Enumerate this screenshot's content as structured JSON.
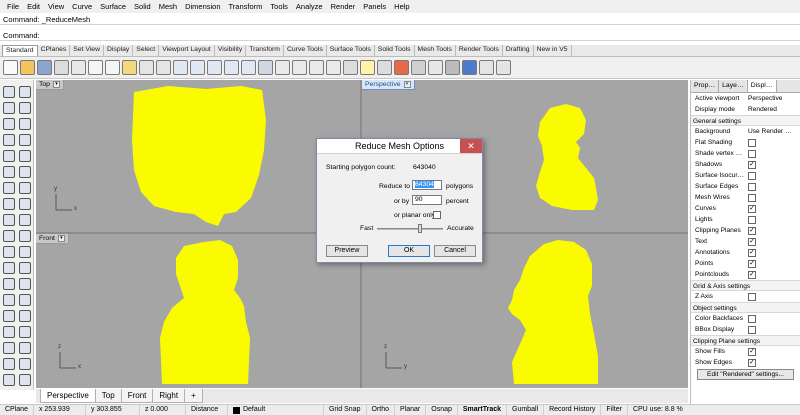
{
  "menu": [
    "File",
    "Edit",
    "View",
    "Curve",
    "Surface",
    "Solid",
    "Mesh",
    "Dimension",
    "Transform",
    "Tools",
    "Analyze",
    "Render",
    "Panels",
    "Help"
  ],
  "command_history": "Command: _ReduceMesh",
  "command_prompt": "Command:",
  "toolbar_tabs": [
    "Standard",
    "CPlanes",
    "Set View",
    "Display",
    "Select",
    "Viewport Layout",
    "Visibility",
    "Transform",
    "Curve Tools",
    "Surface Tools",
    "Solid Tools",
    "Mesh Tools",
    "Render Tools",
    "Drafting",
    "New in V5"
  ],
  "viewports": {
    "top": {
      "title": "Top",
      "axis_x": "x",
      "axis_y": "y"
    },
    "perspective": {
      "title": "Perspective"
    },
    "front": {
      "title": "Front",
      "axis_x": "x",
      "axis_z": "z"
    },
    "right": {
      "title": "Right",
      "axis_y": "y",
      "axis_z": "z"
    }
  },
  "viewport_tabs": [
    "Perspective",
    "Top",
    "Front",
    "Right"
  ],
  "viewport_tab_add": "+",
  "dialog": {
    "title": "Reduce Mesh Options",
    "close": "✕",
    "starting_label": "Starting polygon count:",
    "starting_value": "643040",
    "reduce_to_label": "Reduce to",
    "reduce_to_value": "64304",
    "polygons_label": "polygons",
    "or_by_label": "or by",
    "or_by_value": "90",
    "percent_label": "percent",
    "planar_label": "or planar only",
    "fast_label": "Fast",
    "accurate_label": "Accurate",
    "preview_btn": "Preview",
    "ok_btn": "OK",
    "cancel_btn": "Cancel"
  },
  "panel": {
    "tabs": [
      "Prop…",
      "Laye…",
      "Displ…"
    ],
    "active_viewport_label": "Active viewport",
    "active_viewport_value": "Perspective",
    "display_mode_label": "Display mode",
    "display_mode_value": "Rendered",
    "general_header": "General settings",
    "background_label": "Background",
    "background_value": "Use Render …",
    "general_rows": [
      {
        "label": "Flat Shading",
        "checked": false
      },
      {
        "label": "Shade vertex …",
        "checked": false
      },
      {
        "label": "Shadows",
        "checked": true
      },
      {
        "label": "Surface Isocur…",
        "checked": false
      },
      {
        "label": "Surface Edges",
        "checked": false
      },
      {
        "label": "Mesh Wires",
        "checked": false
      },
      {
        "label": "Curves",
        "checked": true
      },
      {
        "label": "Lights",
        "checked": false
      },
      {
        "label": "Clipping Planes",
        "checked": true
      },
      {
        "label": "Text",
        "checked": true
      },
      {
        "label": "Annotations",
        "checked": true
      },
      {
        "label": "Points",
        "checked": true
      },
      {
        "label": "Pointclouds",
        "checked": true
      }
    ],
    "grid_header": "Grid & Axis settings",
    "grid_rows": [
      {
        "label": "Z Axis",
        "checked": false
      }
    ],
    "object_header": "Object settings",
    "object_rows": [
      {
        "label": "Color Backfaces",
        "checked": false
      },
      {
        "label": "BBox Display",
        "checked": false
      }
    ],
    "clip_header": "Clipping Plane settings",
    "clip_rows": [
      {
        "label": "Show Fills",
        "checked": true
      },
      {
        "label": "Show Edges",
        "checked": true
      }
    ],
    "edit_button": "Edit \"Rendered\" settings...",
    "check_mark": "✓"
  },
  "status": {
    "cplane": "CPlane",
    "x": "x 253.939",
    "y": "y 303.855",
    "z": "z 0.000",
    "distance": "Distance",
    "layer": "Default",
    "grid_snap": "Grid Snap",
    "ortho": "Ortho",
    "planar": "Planar",
    "osnap": "Osnap",
    "smarttrack": "SmartTrack",
    "gumball": "Gumball",
    "record_history": "Record History",
    "filter": "Filter",
    "cpu": "CPU use: 8.8 %"
  },
  "colors": {
    "mesh": "#fbfb00",
    "viewport_bg": "#a5a5a5",
    "accent": "#3399ff"
  }
}
